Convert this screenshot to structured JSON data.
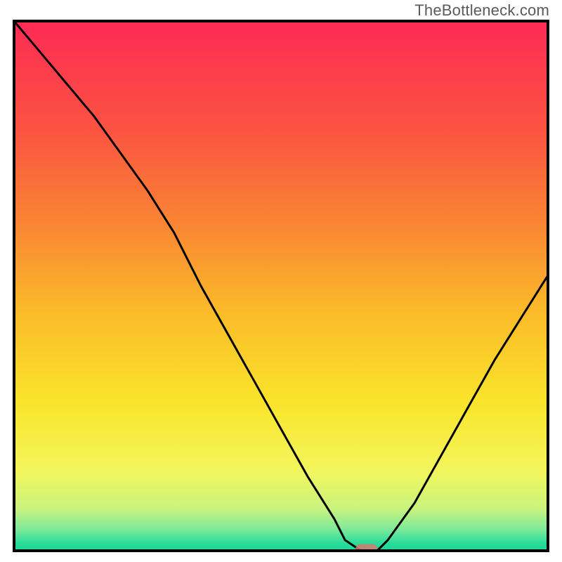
{
  "watermark": "TheBottleneck.com",
  "chart_data": {
    "type": "line",
    "title": "",
    "xlabel": "",
    "ylabel": "",
    "xlim": [
      0,
      100
    ],
    "ylim": [
      0,
      100
    ],
    "grid": false,
    "legend": false,
    "series": [
      {
        "name": "bottleneck-curve",
        "x": [
          0,
          5,
          10,
          15,
          20,
          25,
          30,
          35,
          40,
          45,
          50,
          55,
          60,
          62,
          65,
          68,
          70,
          75,
          80,
          85,
          90,
          95,
          100
        ],
        "y": [
          100,
          94,
          88,
          82,
          75,
          68,
          60,
          50,
          41,
          32,
          23,
          14,
          6,
          2,
          0,
          0,
          2,
          9,
          18,
          27,
          36,
          44,
          52
        ]
      }
    ],
    "marker": {
      "x": 66,
      "y": 0,
      "width": 4,
      "height": 2,
      "color": "#d9776f"
    },
    "background_gradient": {
      "stops": [
        {
          "offset": 0.0,
          "color": "#fc2b54"
        },
        {
          "offset": 0.2,
          "color": "#fb5242"
        },
        {
          "offset": 0.4,
          "color": "#fa8a32"
        },
        {
          "offset": 0.55,
          "color": "#fbbb29"
        },
        {
          "offset": 0.72,
          "color": "#fae42a"
        },
        {
          "offset": 0.85,
          "color": "#f3f65d"
        },
        {
          "offset": 0.92,
          "color": "#c9f37d"
        },
        {
          "offset": 0.96,
          "color": "#7de99a"
        },
        {
          "offset": 0.985,
          "color": "#2bdc9b"
        },
        {
          "offset": 1.0,
          "color": "#1dd796"
        }
      ]
    }
  }
}
